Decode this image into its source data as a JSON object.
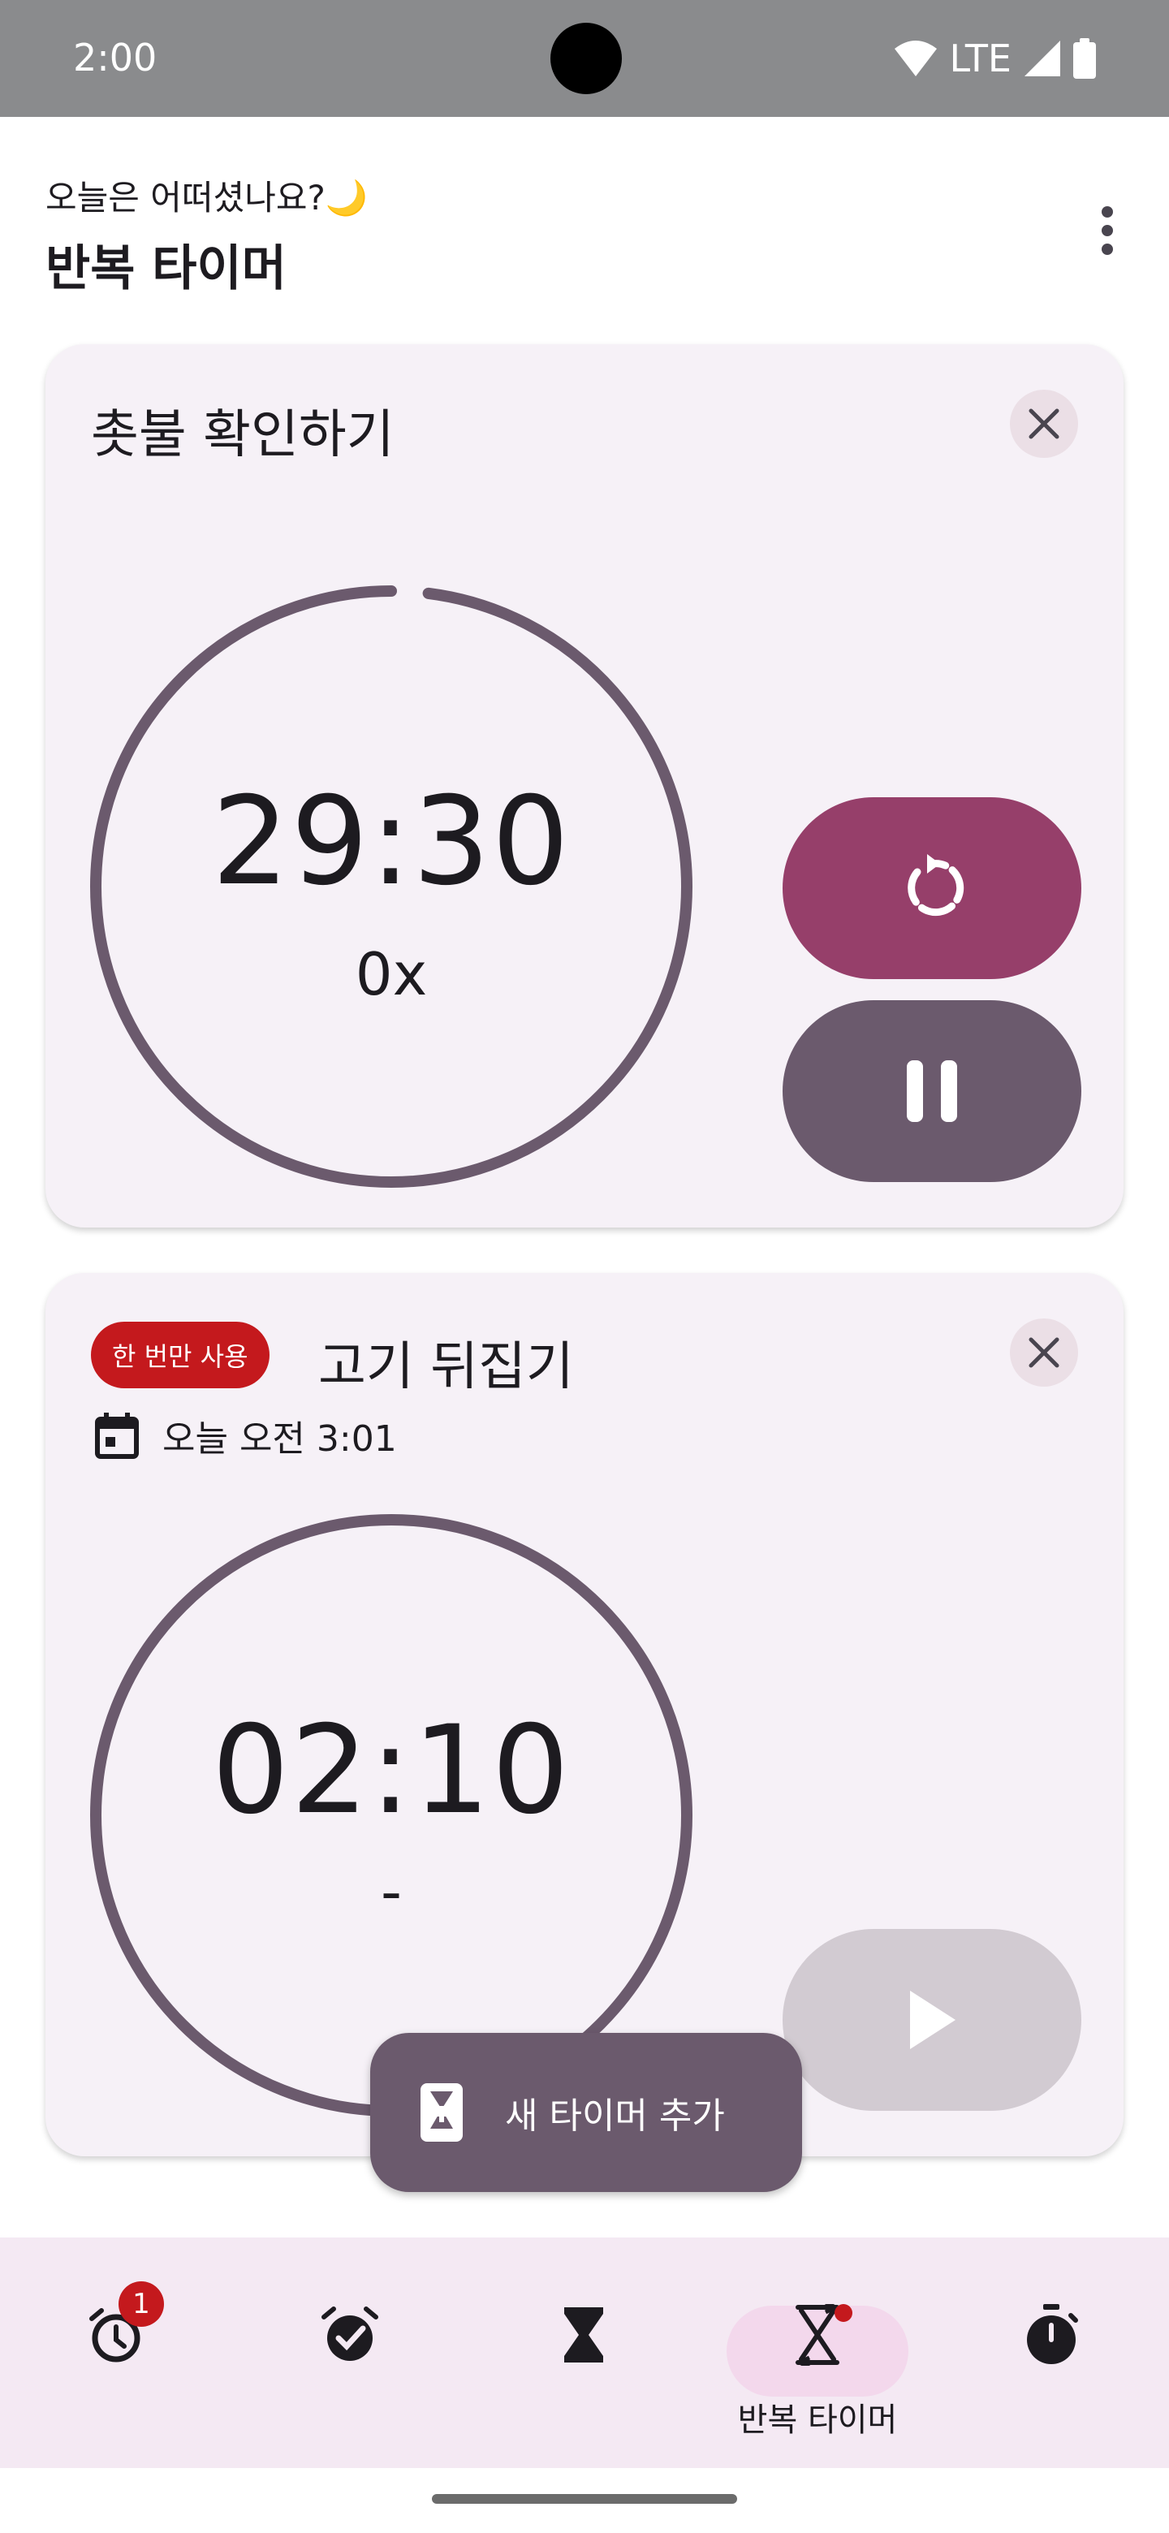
{
  "status_bar": {
    "time": "2:00",
    "network": "LTE"
  },
  "header": {
    "greeting": "오늘은 어떠셨나요?🌙",
    "title": "반복 타이머"
  },
  "timers": [
    {
      "title": "촛불 확인하기",
      "time": "29:30",
      "count": "0x",
      "progress_fraction": 0.98,
      "buttons": [
        "reset-icon",
        "pause-icon"
      ]
    },
    {
      "badge": "한 번만 사용",
      "title": "고기 뒤집기",
      "date": "오늘 오전 3:01",
      "time": "02:10",
      "count": "-",
      "buttons": [
        "play-icon"
      ]
    }
  ],
  "fab": {
    "label": "새 타이머 추가"
  },
  "bottom_nav": {
    "items": [
      {
        "icon": "alarm-icon",
        "badge": "1"
      },
      {
        "icon": "reminder-check-icon"
      },
      {
        "icon": "hourglass-icon"
      },
      {
        "icon": "repeat-timer-icon",
        "label": "반복 타이머",
        "selected": true
      },
      {
        "icon": "stopwatch-icon"
      }
    ]
  },
  "colors": {
    "card_bg": "#f6f1f7",
    "ring": "#6b5a6d",
    "reset_button": "#963f6a",
    "pause_button": "#6b5a6d",
    "play_button_disabled": "#d2cbd2",
    "badge_red": "#c4191d",
    "nav_bg": "#f4e9f3",
    "nav_indicator": "#f3d8ec"
  }
}
